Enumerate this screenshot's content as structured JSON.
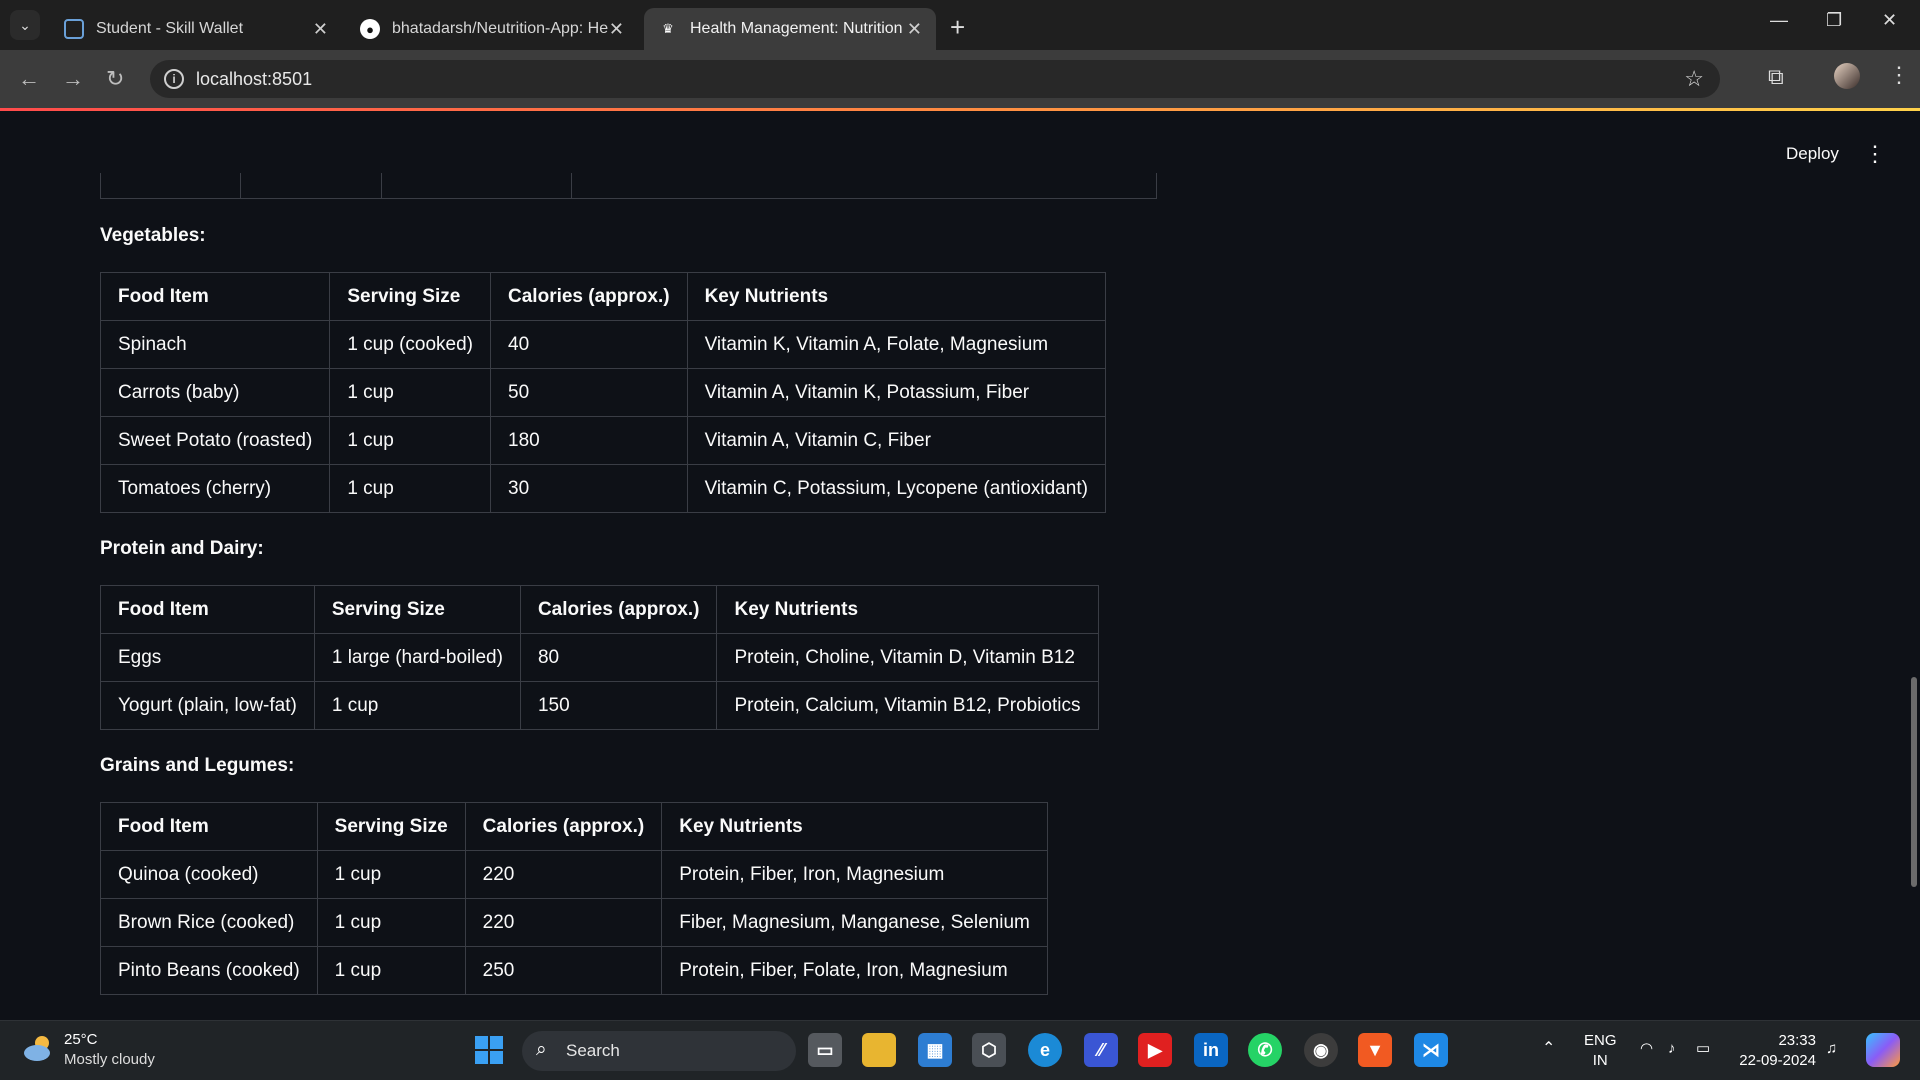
{
  "browser": {
    "tabs": [
      {
        "label": "Student - Skill Wallet",
        "active": false,
        "icon": "skill-wallet-icon"
      },
      {
        "label": "bhatadarsh/Neutrition-App: He",
        "active": false,
        "icon": "github-icon"
      },
      {
        "label": "Health Management: Nutrition",
        "active": true,
        "icon": "streamlit-icon"
      }
    ],
    "url": "localhost:8501"
  },
  "app": {
    "deploy_label": "Deploy",
    "sections": [
      {
        "title": "Vegetables:",
        "headers": [
          "Food Item",
          "Serving Size",
          "Calories (approx.)",
          "Key Nutrients"
        ],
        "rows": [
          [
            "Spinach",
            "1 cup (cooked)",
            "40",
            "Vitamin K, Vitamin A, Folate, Magnesium"
          ],
          [
            "Carrots (baby)",
            "1 cup",
            "50",
            "Vitamin A, Vitamin K, Potassium, Fiber"
          ],
          [
            "Sweet Potato (roasted)",
            "1 cup",
            "180",
            "Vitamin A, Vitamin C, Fiber"
          ],
          [
            "Tomatoes (cherry)",
            "1 cup",
            "30",
            "Vitamin C, Potassium, Lycopene (antioxidant)"
          ]
        ]
      },
      {
        "title": "Protein and Dairy:",
        "headers": [
          "Food Item",
          "Serving Size",
          "Calories (approx.)",
          "Key Nutrients"
        ],
        "rows": [
          [
            "Eggs",
            "1 large (hard-boiled)",
            "80",
            "Protein, Choline, Vitamin D, Vitamin B12"
          ],
          [
            "Yogurt (plain, low-fat)",
            "1 cup",
            "150",
            "Protein, Calcium, Vitamin B12, Probiotics"
          ]
        ]
      },
      {
        "title": "Grains and Legumes:",
        "headers": [
          "Food Item",
          "Serving Size",
          "Calories (approx.)",
          "Key Nutrients"
        ],
        "rows": [
          [
            "Quinoa (cooked)",
            "1 cup",
            "220",
            "Protein, Fiber, Iron, Magnesium"
          ],
          [
            "Brown Rice (cooked)",
            "1 cup",
            "220",
            "Fiber, Magnesium, Manganese, Selenium"
          ],
          [
            "Pinto Beans (cooked)",
            "1 cup",
            "250",
            "Protein, Fiber, Folate, Iron, Magnesium"
          ]
        ]
      }
    ]
  },
  "taskbar": {
    "weather_temp": "25°C",
    "weather_desc": "Mostly cloudy",
    "search_label": "Search",
    "lang_line1": "ENG",
    "lang_line2": "IN",
    "time": "23:33",
    "date": "22-09-2024"
  }
}
